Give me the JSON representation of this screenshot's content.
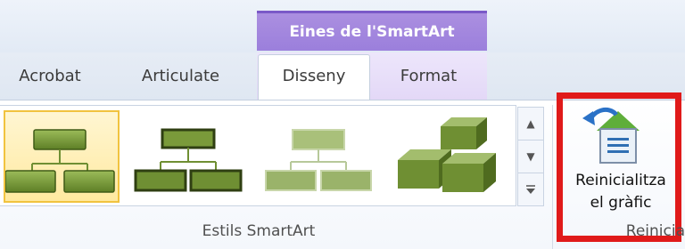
{
  "contextual_tab_group": {
    "label": "Eines de l'SmartArt",
    "color": "#9b7fdc"
  },
  "tabs": [
    {
      "label": "Acrobat",
      "active": false
    },
    {
      "label": "Articulate",
      "active": false
    },
    {
      "label": "Disseny",
      "active": true
    },
    {
      "label": "Format",
      "active": false
    }
  ],
  "groups": {
    "styles": {
      "label": "Estils SmartArt",
      "items": [
        {
          "name": "Org chart style 1",
          "selected": true
        },
        {
          "name": "Org chart style 2",
          "selected": false
        },
        {
          "name": "Org chart style 3",
          "selected": false
        },
        {
          "name": "3D blocks style",
          "selected": false
        }
      ],
      "scroll_icons": [
        "scroll-up-icon",
        "scroll-down-icon",
        "more-icon"
      ]
    },
    "reset": {
      "label": "Reinicia",
      "button_line1": "Reinicialitza",
      "button_line2": "el gràfic",
      "icon": "reset-graphic-icon",
      "highlight_color": "#e01a1a"
    }
  },
  "colors": {
    "shape_green": "#6f8f33",
    "selection_gold": "#f1c33f"
  }
}
